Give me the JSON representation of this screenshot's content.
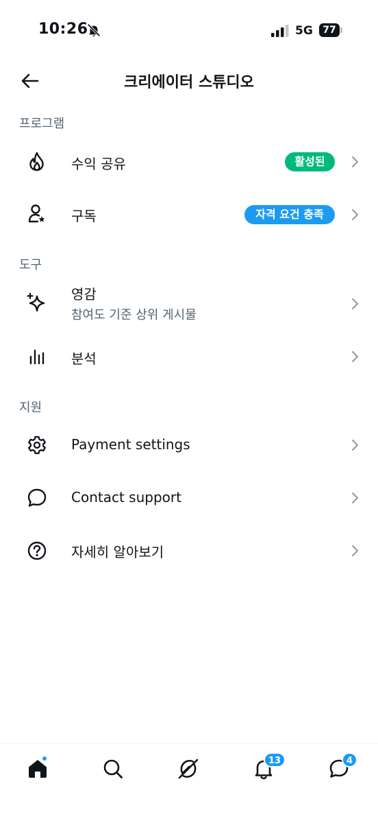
{
  "status_bar": {
    "time": "10:26",
    "network": "5G",
    "battery": "77"
  },
  "header": {
    "title": "크리에이터 스튜디오"
  },
  "sections": {
    "programs": {
      "title": "프로그램",
      "revenue_sharing": {
        "label": "수익 공유",
        "badge": "활성된",
        "badge_color": "#00ba7c"
      },
      "subscriptions": {
        "label": "구독",
        "badge": "자격 요건 충족",
        "badge_color": "#1d9bf0"
      }
    },
    "tools": {
      "title": "도구",
      "inspiration": {
        "label": "영감",
        "sublabel": "참여도 기준 상위 게시물"
      },
      "analytics": {
        "label": "분석"
      }
    },
    "support": {
      "title": "지원",
      "payment_settings": {
        "label": "Payment settings"
      },
      "contact_support": {
        "label": "Contact support"
      },
      "learn_more": {
        "label": "자세히 알아보기"
      }
    }
  },
  "tab_bar": {
    "notifications_count": "13",
    "messages_count": "4",
    "accent_color": "#1d9bf0"
  }
}
